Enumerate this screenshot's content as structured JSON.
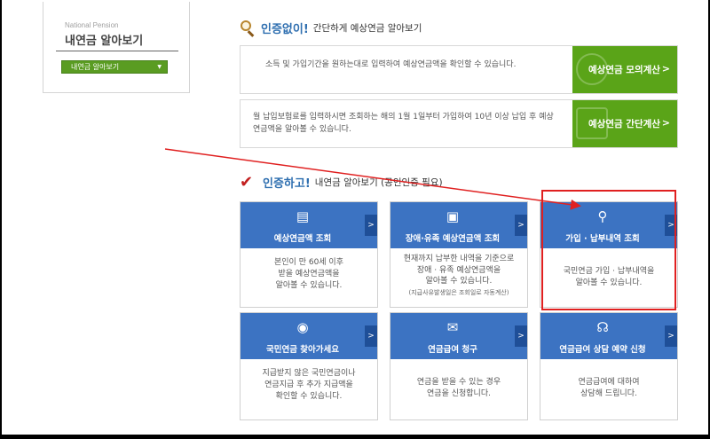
{
  "sidebar": {
    "subtitle": "National Pension",
    "title": "내연금 알아보기",
    "select_value": "내연금 알아보기"
  },
  "section1": {
    "highlight": "인증없이!",
    "rest": "간단하게 예상연금 알아보기"
  },
  "calc": [
    {
      "desc": "소득 및 가입기간을 원하는대로 입력하여 예상연금액을 확인할 수 있습니다.",
      "button": "예상연금 모의계산"
    },
    {
      "desc": "월 납입보험료를 입력하시면 조회하는 해의 1월 1일부터 가입하여 10년 이상 납입 후 예상연금액을 알아볼 수 있습니다.",
      "button": "예상연금 간단계산"
    }
  ],
  "section2": {
    "highlight": "인증하고!",
    "rest": "내연금 알아보기 (공인인증 필요)"
  },
  "cards": [
    {
      "title": "예상연금액 조회",
      "icon": "document-icon",
      "glyph": "▤",
      "lines": [
        "본인이 만 60세 이후",
        "받을 예상연금액을",
        "알아볼 수 있습니다."
      ],
      "note": ""
    },
    {
      "title": "장애·유족 예상연금액 조회",
      "icon": "id-card-icon",
      "glyph": "▣",
      "lines": [
        "현재까지 납부한 내역을 기준으로",
        "장애 · 유족 예상연금액을",
        "알아볼 수 있습니다."
      ],
      "note": "(지급사유발생일은 조회일로 자동계산)"
    },
    {
      "title": "가입 · 납부내역 조회",
      "icon": "magnifier-icon",
      "glyph": "⚲",
      "lines": [
        "국민연금 가입 · 납부내역을",
        "알아볼 수 있습니다."
      ],
      "note": ""
    },
    {
      "title": "국민연금 찾아가세요",
      "icon": "coin-jar-icon",
      "glyph": "◉",
      "lines": [
        "지급받지 않은 국민연금이나",
        "연금지급 후 추가 지급액을",
        "확인할 수 있습니다."
      ],
      "note": ""
    },
    {
      "title": "연금급여 청구",
      "icon": "envelope-icon",
      "glyph": "✉",
      "lines": [
        "연금을 받을 수 있는 경우",
        "연금을 신청합니다."
      ],
      "note": ""
    },
    {
      "title": "연금급여 상담 예약 신청",
      "icon": "headset-icon",
      "glyph": "☊",
      "lines": [
        "연금급여에 대하여",
        "상담해 드립니다."
      ],
      "note": ""
    }
  ],
  "colors": {
    "card_blue": "#3c73c2",
    "calc_green": "#5aa418",
    "annotation_red": "#e02020"
  }
}
